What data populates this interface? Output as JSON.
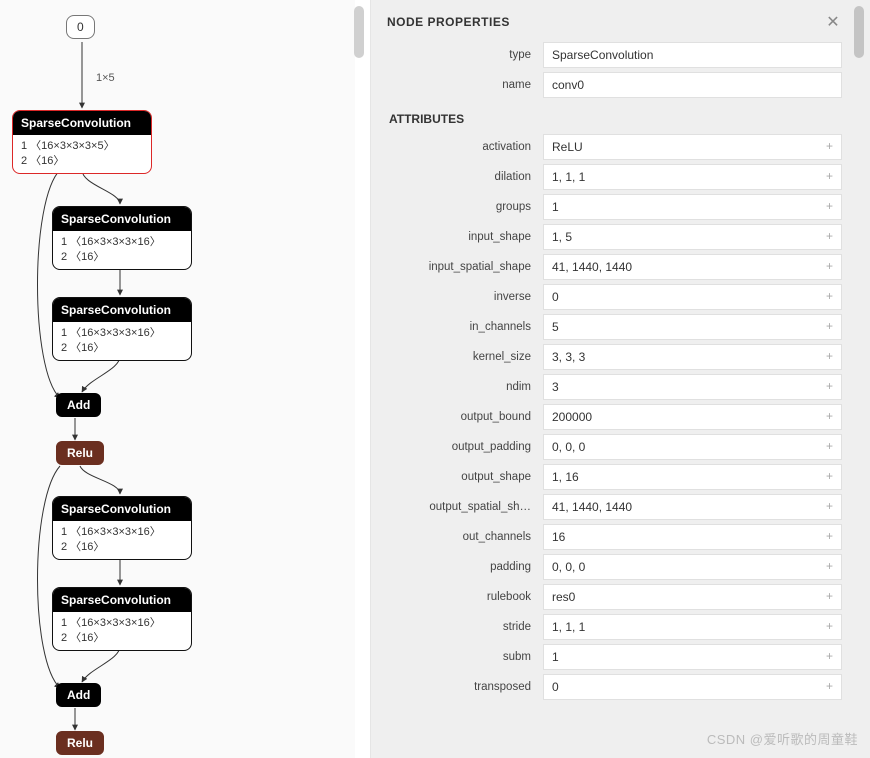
{
  "graph": {
    "input_node": {
      "label": "0"
    },
    "edge_label": "1×5",
    "nodes": [
      {
        "title": "SparseConvolution",
        "l1": "1 〈16×3×3×3×5〉",
        "l2": "2 〈16〉",
        "selected": true
      },
      {
        "title": "SparseConvolution",
        "l1": "1 〈16×3×3×3×16〉",
        "l2": "2 〈16〉",
        "selected": false
      },
      {
        "title": "SparseConvolution",
        "l1": "1 〈16×3×3×3×16〉",
        "l2": "2 〈16〉",
        "selected": false
      },
      {
        "title": "Add"
      },
      {
        "title": "Relu"
      },
      {
        "title": "SparseConvolution",
        "l1": "1 〈16×3×3×3×16〉",
        "l2": "2 〈16〉",
        "selected": false
      },
      {
        "title": "SparseConvolution",
        "l1": "1 〈16×3×3×3×16〉",
        "l2": "2 〈16〉",
        "selected": false
      },
      {
        "title": "Add"
      },
      {
        "title": "Relu"
      }
    ]
  },
  "panel": {
    "header": "NODE PROPERTIES",
    "type_label": "type",
    "type_value": "SparseConvolution",
    "name_label": "name",
    "name_value": "conv0",
    "attributes_label": "ATTRIBUTES",
    "attrs": {
      "activation": {
        "label": "activation",
        "value": "ReLU"
      },
      "dilation": {
        "label": "dilation",
        "value": "1, 1, 1"
      },
      "groups": {
        "label": "groups",
        "value": "1"
      },
      "input_shape": {
        "label": "input_shape",
        "value": "1, 5"
      },
      "input_spatial_shape": {
        "label": "input_spatial_shape",
        "value": "41, 1440, 1440"
      },
      "inverse": {
        "label": "inverse",
        "value": "0"
      },
      "in_channels": {
        "label": "in_channels",
        "value": "5"
      },
      "kernel_size": {
        "label": "kernel_size",
        "value": "3, 3, 3"
      },
      "ndim": {
        "label": "ndim",
        "value": "3"
      },
      "output_bound": {
        "label": "output_bound",
        "value": "200000"
      },
      "output_padding": {
        "label": "output_padding",
        "value": "0, 0, 0"
      },
      "output_shape": {
        "label": "output_shape",
        "value": "1, 16"
      },
      "output_spatial_shape": {
        "label": "output_spatial_sh…",
        "value": "41, 1440, 1440"
      },
      "out_channels": {
        "label": "out_channels",
        "value": "16"
      },
      "padding": {
        "label": "padding",
        "value": "0, 0, 0"
      },
      "rulebook": {
        "label": "rulebook",
        "value": "res0"
      },
      "stride": {
        "label": "stride",
        "value": "1, 1, 1"
      },
      "subm": {
        "label": "subm",
        "value": "1"
      },
      "transposed": {
        "label": "transposed",
        "value": "0"
      }
    }
  },
  "watermark": "CSDN @爱听歌的周童鞋"
}
